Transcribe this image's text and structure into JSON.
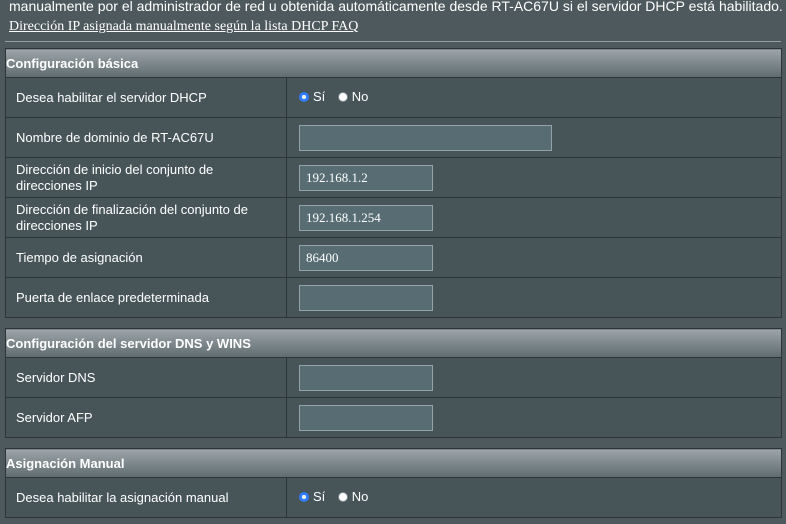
{
  "intro_text": "manualmente por el administrador de red u obtenida automáticamente desde RT-AC67U si el servidor DHCP está habilitado.",
  "faq_link": "Dirección IP asignada manualmente según la lista DHCP FAQ",
  "sections": {
    "basic": {
      "title": "Configuración básica",
      "dhcp_label": "Desea habilitar el servidor DHCP",
      "domain_label": "Nombre de dominio de RT-AC67U",
      "domain_value": "",
      "start_label": "Dirección de inicio del conjunto de direcciones IP",
      "start_value": "192.168.1.2",
      "end_label": "Dirección de finalización del conjunto de direcciones IP",
      "end_value": "192.168.1.254",
      "lease_label": "Tiempo de asignación",
      "lease_value": "86400",
      "gateway_label": "Puerta de enlace predeterminada",
      "gateway_value": ""
    },
    "dns": {
      "title": "Configuración del servidor DNS y WINS",
      "dns_label": "Servidor DNS",
      "dns_value": "",
      "afp_label": "Servidor AFP",
      "afp_value": ""
    },
    "manual": {
      "title": "Asignación Manual",
      "enable_label": "Desea habilitar la asignación manual"
    }
  },
  "radio": {
    "yes": "Sí",
    "no": "No"
  },
  "selected": {
    "dhcp": "yes",
    "manual": "yes"
  }
}
